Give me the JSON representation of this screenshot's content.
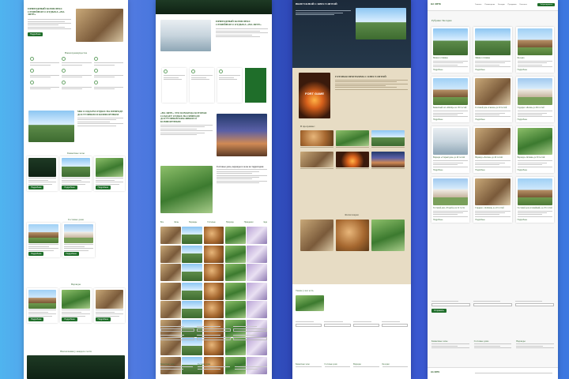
{
  "strip1": {
    "hero_title": "ПРИРОДНЫЙ КОМПЛЕКС СЕМЕЙНОГО ОТДЫХА «НА ЗЯТЕ»",
    "section_why": "Наши преимущества",
    "section_team": "МЫ СОЗДАЕМ ОТДЫХ НА ПРИРОДЕ ДОСТУПНЫМ И КОМФОРТНЫМ",
    "section_houses": "Банкетные залы",
    "section_cottages": "Гостевые дома",
    "section_verandas": "Веранды",
    "footer_title": "Впечатления у каждого гостя",
    "button": "Подробнее"
  },
  "strip2": {
    "hero_title": "ПРИРОДНЫЙ КОМПЛЕКС СЕМЕЙНОГО ОТДЫХА «НА ЗЯТЕ»",
    "team_title": "«НА ЗЯТЕ» ЭТО КОМАНДА КОТОРАЯ СОЗДАЕТ ОТДЫХ НА ПРИРОДЕ ДОСТУПНЫМ КРАСИВЫМ И КОМФОРТНЫМ",
    "offer_title": "Гостевые дома, веранды и залы на территории",
    "gallery_tabs": [
      "Все",
      "Залы",
      "Веранды",
      "Гостевые",
      "Природа",
      "Праздники",
      "Еда"
    ],
    "footer_cols": [
      "Банкетные залы",
      "Гостевые дома",
      "Веранды"
    ]
  },
  "strip3": {
    "hero_title": "ВЫПУСКНОЙ С КВЕСТ-ИГРОЙ",
    "program_title": "ГОТОВАЯ ПРОГРАММА С КВЕСТ-ИГРОЙ",
    "poster_text": "FORT GAME",
    "in_program": "В программе:",
    "photo_title": "Фотогалерея",
    "contact_title": "Также у нас есть",
    "footer_cols": [
      "Банкетные залы",
      "Гостевые дома",
      "Веранды",
      "Беседки"
    ]
  },
  "strip4": {
    "logo": "НА ЗЯТЕ",
    "nav": [
      "Главная",
      "Размещение",
      "Беседки",
      "Праздники",
      "Контакты"
    ],
    "cta": "Забронировать",
    "title": "Рубрика: Беседки",
    "cards": [
      "Мини-гостиница",
      "Мини-гостиница",
      "Беседка",
      "Банкетный зал «Шатёр» на 150 гостей",
      "Гостевой дом «Сказка» до 20 гостей",
      "Гардерес «Белая» до 60 гостей",
      "Веранда «Старый дом» до 40 гостей",
      "Веранда «Лесная» до 40 гостей",
      "Веранда «Летняя» до 30 гостей",
      "Гостевой дом «Усадьба» на 22 гостя",
      "Гардерес «Зелёная» до 22 гостей",
      "Гостевой дом «Семейный» до 25 гостей"
    ],
    "more": "Подробнее",
    "form_button": "Отправить",
    "footer_cols": [
      "Банкетные залы",
      "Гостевые дома",
      "Веранды"
    ]
  }
}
